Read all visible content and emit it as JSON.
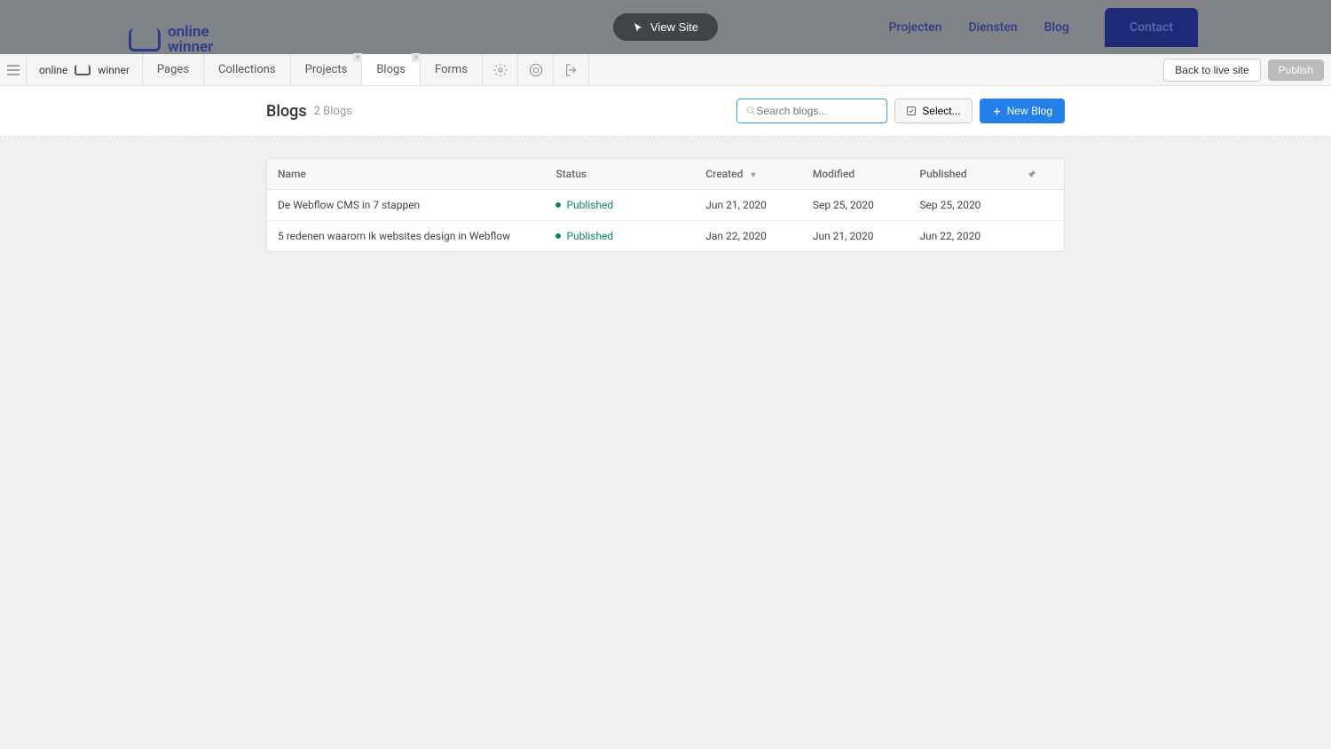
{
  "hero": {
    "logo_text_top": "online",
    "logo_text_bottom": "winner",
    "view_site_label": "View Site",
    "nav": [
      "Projecten",
      "Diensten",
      "Blog"
    ],
    "contact_label": "Contact"
  },
  "editor": {
    "brand_left": "online",
    "brand_right": "winner",
    "tabs": [
      {
        "label": "Pages",
        "closable": false
      },
      {
        "label": "Collections",
        "closable": false
      },
      {
        "label": "Projects",
        "closable": true
      },
      {
        "label": "Blogs",
        "closable": true,
        "active": true
      },
      {
        "label": "Forms",
        "closable": false
      }
    ],
    "back_label": "Back to live site",
    "publish_label": "Publish"
  },
  "header": {
    "title": "Blogs",
    "count": "2 Blogs",
    "search_placeholder": "Search blogs...",
    "select_label": "Select...",
    "new_label": "New Blog"
  },
  "table": {
    "columns": [
      "Name",
      "Status",
      "Created",
      "Modified",
      "Published"
    ],
    "rows": [
      {
        "name": "De Webflow CMS in 7 stappen",
        "status": "Published",
        "created": "Jun 21, 2020",
        "modified": "Sep 25, 2020",
        "published": "Sep 25, 2020"
      },
      {
        "name": "5 redenen waarom ik websites design in Webflow",
        "status": "Published",
        "created": "Jan 22, 2020",
        "modified": "Jun 21, 2020",
        "published": "Jun 22, 2020"
      }
    ]
  }
}
